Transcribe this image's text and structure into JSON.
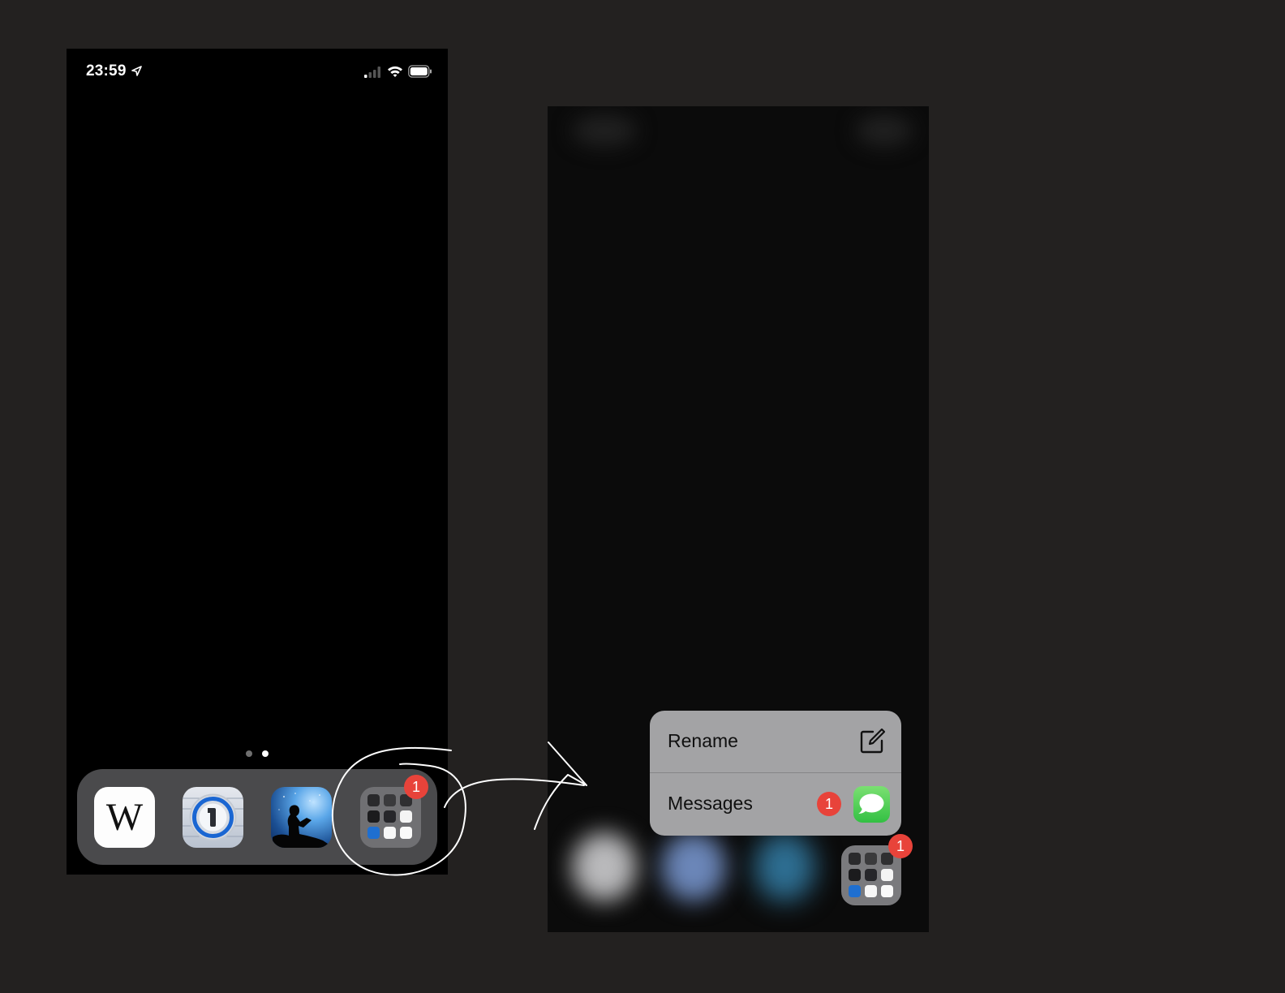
{
  "left_phone": {
    "status_bar": {
      "time": "23:59",
      "icons": [
        "location-arrow-icon",
        "cellular-signal-icon",
        "wifi-icon",
        "battery-icon"
      ]
    },
    "page_indicator": {
      "pages": 2,
      "current": 2
    },
    "dock": {
      "apps": [
        {
          "name": "Wikipedia",
          "icon": "wikipedia-icon",
          "glyph": "W"
        },
        {
          "name": "1Password",
          "icon": "1password-icon"
        },
        {
          "name": "Kindle",
          "icon": "kindle-icon"
        },
        {
          "name": "Folder",
          "icon": "folder-icon",
          "badge": "1"
        }
      ]
    }
  },
  "right_phone": {
    "context_menu": {
      "items": [
        {
          "label": "Rename",
          "icon": "compose-edit-icon"
        },
        {
          "label": "Messages",
          "badge": "1",
          "icon": "messages-app-icon"
        }
      ]
    },
    "folder": {
      "icon": "folder-icon",
      "badge": "1"
    }
  },
  "colors": {
    "background": "#232120",
    "badge": "#e8433a",
    "menu": "#a3a3a5",
    "dock": "#4a4a4c",
    "messages_green": "#4cd964"
  }
}
